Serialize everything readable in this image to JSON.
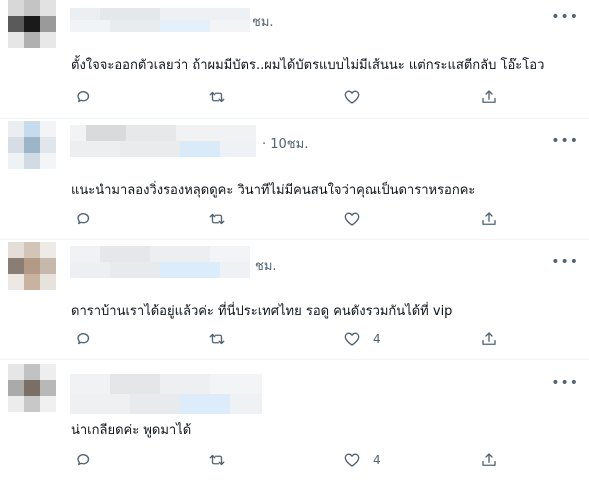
{
  "tweets": [
    {
      "time": "ชม.",
      "text": "ตั้งใจจะออกตัวเลยว่า ถ้าผมมีบัตร..ผมได้บัตรแบบไม่มีเส้นนะ แต่กระแสตีกลับ โอ๊ะโอว",
      "likes": "",
      "avatar_colors": [
        "#d8d8d8",
        "#c4c4c4",
        "#e2e2e2",
        "#5a5a5a",
        "#1a1a1a",
        "#9a9a9a",
        "#e6e6e6",
        "#b0b0b0",
        "#e8e8e8"
      ]
    },
    {
      "time": "· 10ชม.",
      "text": "แนะนำมาลองวิ่งรองหลุดดูคะ วินาทีไม่มีคนสนใจว่าคุณเป็นดาราหรอกคะ",
      "likes": "",
      "avatar_colors": [
        "#eaeef2",
        "#c6dcee",
        "#f2f4f6",
        "#d6dde4",
        "#9eb4c8",
        "#e0e6ec",
        "#eef2f5",
        "#d2dbe3",
        "#f3f5f7"
      ]
    },
    {
      "time": "ชม.",
      "text": "ดาราบ้านเราได้อยู่แล้วค่ะ ที่นี่ประเทศไทย รอดู คนดังรวมกันได้ที่ vip",
      "likes": "4",
      "avatar_colors": [
        "#e4ddd8",
        "#d3c4b8",
        "#eeeae6",
        "#8a7e74",
        "#b39a86",
        "#c6b8ac",
        "#ede8e4",
        "#c9b2a0",
        "#e8e2dc"
      ]
    },
    {
      "time": "",
      "text": "น่าเกลียดค่ะ พูดมาได้",
      "likes": "4",
      "avatar_colors": [
        "#e6e6e6",
        "#c2c2c2",
        "#eeeeee",
        "#aaaaaa",
        "#7a6e66",
        "#b8b8b8",
        "#ececec",
        "#c8c8c8",
        "#f0f0f0"
      ]
    }
  ],
  "icons": {
    "reply": "reply-icon",
    "retweet": "retweet-icon",
    "like": "heart-icon",
    "share": "share-icon",
    "more": "more-icon"
  },
  "colors": {
    "text": "#0f1419",
    "muted": "#536471",
    "divider": "#eff3f4"
  }
}
